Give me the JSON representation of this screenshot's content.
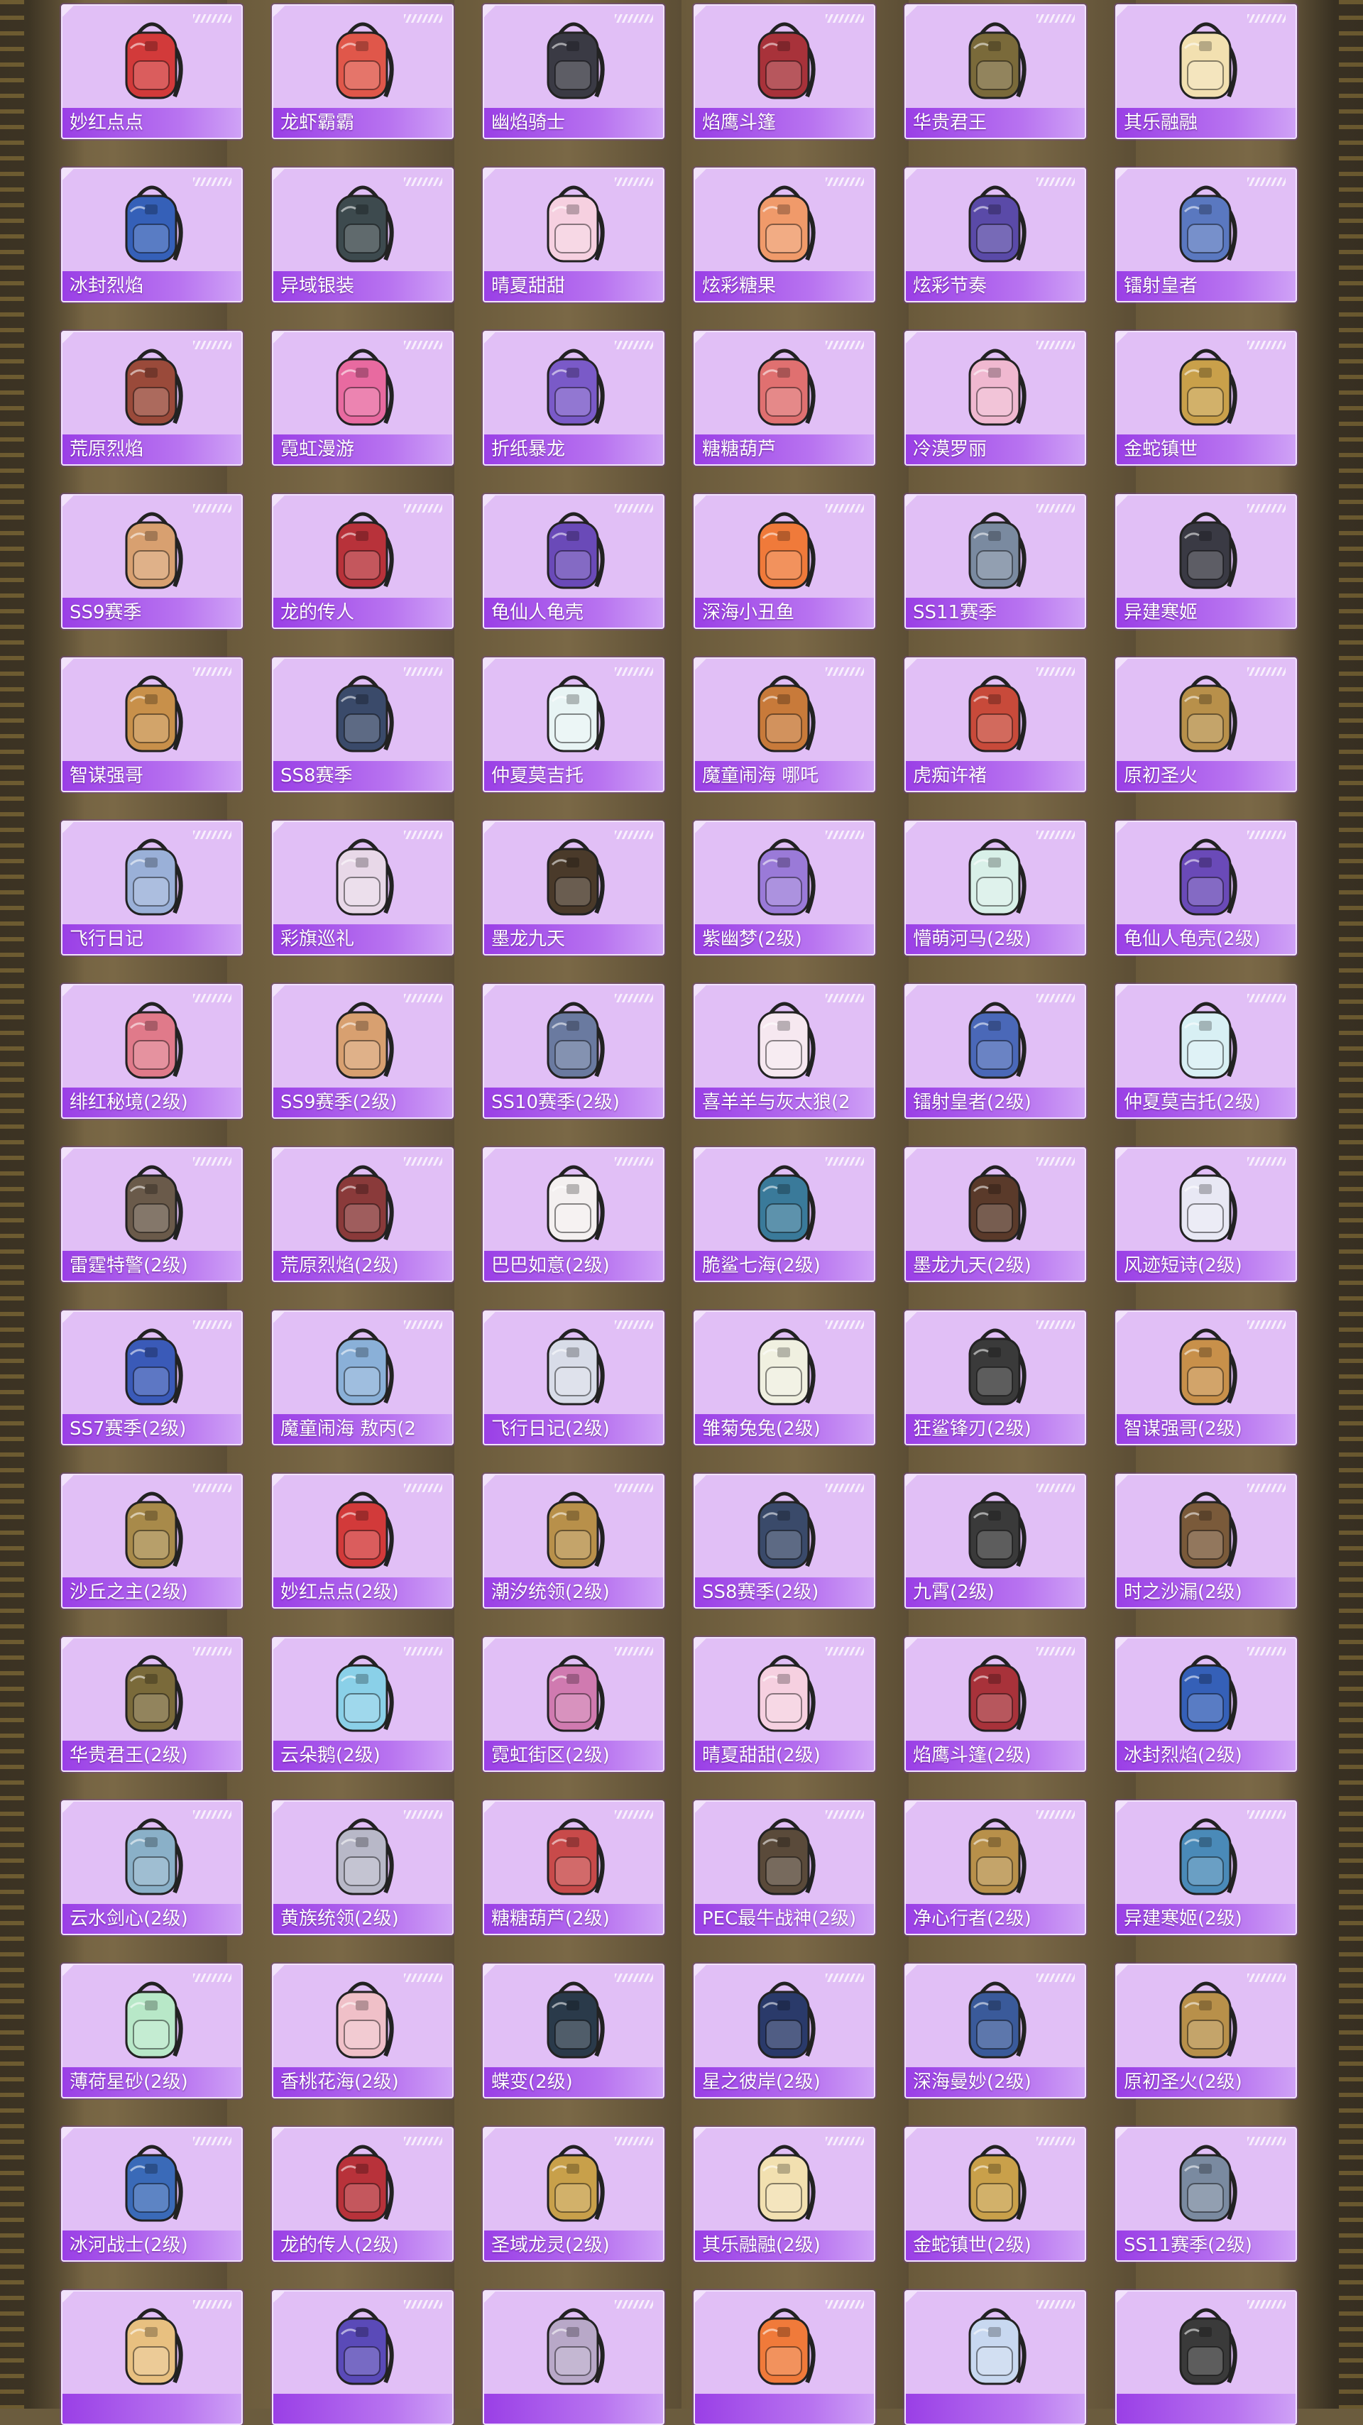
{
  "colors": {
    "card_bg": "#e1bff6",
    "label_bar": "#9a3fe6",
    "label_text": "#ffffff",
    "page_bg": "#6b5c3e"
  },
  "items": [
    {
      "name": "妙红点点",
      "icon": "backpack-icon",
      "color": "#d23a3a"
    },
    {
      "name": "龙虾霸霸",
      "icon": "backpack-icon",
      "color": "#e0574a"
    },
    {
      "name": "幽焰骑士",
      "icon": "backpack-icon",
      "color": "#3a3a44"
    },
    {
      "name": "焰鹰斗篷",
      "icon": "backpack-icon",
      "color": "#a8323a"
    },
    {
      "name": "华贵君王",
      "icon": "backpack-icon",
      "color": "#7a6a3a"
    },
    {
      "name": "其乐融融",
      "icon": "backpack-icon",
      "color": "#f2e0b0"
    },
    {
      "name": "冰封烈焰",
      "icon": "backpack-icon",
      "color": "#3560b8"
    },
    {
      "name": "异域银装",
      "icon": "backpack-icon",
      "color": "#3d4a4e"
    },
    {
      "name": "晴夏甜甜",
      "icon": "backpack-icon",
      "color": "#f6d0e0"
    },
    {
      "name": "炫彩糖果",
      "icon": "backpack-icon",
      "color": "#f09a6a"
    },
    {
      "name": "炫彩节奏",
      "icon": "backpack-icon",
      "color": "#5a4aa8"
    },
    {
      "name": "镭射皇者",
      "icon": "backpack-icon",
      "color": "#5a78c0"
    },
    {
      "name": "荒原烈焰",
      "icon": "backpack-icon",
      "color": "#9a4a3a"
    },
    {
      "name": "霓虹漫游",
      "icon": "backpack-icon",
      "color": "#e86aa0"
    },
    {
      "name": "折纸暴龙",
      "icon": "backpack-icon",
      "color": "#7a5ac8"
    },
    {
      "name": "糖糖葫芦",
      "icon": "backpack-icon",
      "color": "#e07070"
    },
    {
      "name": "冷漠罗丽",
      "icon": "backpack-icon",
      "color": "#f0b8d0"
    },
    {
      "name": "金蛇镇世",
      "icon": "backpack-icon",
      "color": "#c9a04a"
    },
    {
      "name": "SS9赛季",
      "icon": "backpack-icon",
      "color": "#d8a070"
    },
    {
      "name": "龙的传人",
      "icon": "backpack-icon",
      "color": "#b8323a"
    },
    {
      "name": "龟仙人龟壳",
      "icon": "backpack-icon",
      "color": "#6a4ab8"
    },
    {
      "name": "深海小丑鱼",
      "icon": "backpack-icon",
      "color": "#f07a3a"
    },
    {
      "name": "SS11赛季",
      "icon": "backpack-icon",
      "color": "#7a8aa0"
    },
    {
      "name": "异建寒姬",
      "icon": "backpack-icon",
      "color": "#3a3a44"
    },
    {
      "name": "智谋强哥",
      "icon": "backpack-icon",
      "color": "#c8904a"
    },
    {
      "name": "SS8赛季",
      "icon": "backpack-icon",
      "color": "#3a4a6a"
    },
    {
      "name": "仲夏莫吉托",
      "icon": "backpack-icon",
      "color": "#e8f4f4"
    },
    {
      "name": "魔童闹海 哪吒",
      "icon": "backpack-icon",
      "color": "#c87a3a"
    },
    {
      "name": "虎痴许褚",
      "icon": "backpack-icon",
      "color": "#c84a3a"
    },
    {
      "name": "原初圣火",
      "icon": "backpack-icon",
      "color": "#b8904a"
    },
    {
      "name": "飞行日记",
      "icon": "backpack-icon",
      "color": "#9ab0d8"
    },
    {
      "name": "彩旗巡礼",
      "icon": "backpack-icon",
      "color": "#e8d8e8"
    },
    {
      "name": "墨龙九天",
      "icon": "backpack-icon",
      "color": "#4a3a2a"
    },
    {
      "name": "紫幽梦(2级)",
      "icon": "backpack-icon",
      "color": "#9a7ad8"
    },
    {
      "name": "懵萌河马(2级)",
      "icon": "backpack-icon",
      "color": "#d8f0e8"
    },
    {
      "name": "龟仙人龟壳(2级)",
      "icon": "backpack-icon",
      "color": "#6a4ab8"
    },
    {
      "name": "绯红秘境(2级)",
      "icon": "backpack-icon",
      "color": "#e07a8a"
    },
    {
      "name": "SS9赛季(2级)",
      "icon": "backpack-icon",
      "color": "#d8a070"
    },
    {
      "name": "SS10赛季(2级)",
      "icon": "backpack-icon",
      "color": "#6a7aa0"
    },
    {
      "name": "喜羊羊与灰太狼(2",
      "icon": "backpack-icon",
      "color": "#f6e8f0"
    },
    {
      "name": "镭射皇者(2级)",
      "icon": "backpack-icon",
      "color": "#4a68b8"
    },
    {
      "name": "仲夏莫吉托(2级)",
      "icon": "backpack-icon",
      "color": "#d8f0f4"
    },
    {
      "name": "雷霆特警(2级)",
      "icon": "backpack-icon",
      "color": "#6a5a4a"
    },
    {
      "name": "荒原烈焰(2级)",
      "icon": "backpack-icon",
      "color": "#8a3a3a"
    },
    {
      "name": "巴巴如意(2级)",
      "icon": "backpack-icon",
      "color": "#f4f0f0"
    },
    {
      "name": "脆鲨七海(2级)",
      "icon": "backpack-icon",
      "color": "#3a7a9a"
    },
    {
      "name": "墨龙九天(2级)",
      "icon": "backpack-icon",
      "color": "#5a3a2a"
    },
    {
      "name": "风迹短诗(2级)",
      "icon": "backpack-icon",
      "color": "#e8e8f4"
    },
    {
      "name": "SS7赛季(2级)",
      "icon": "backpack-icon",
      "color": "#3a5ab8"
    },
    {
      "name": "魔童闹海 敖丙(2",
      "icon": "backpack-icon",
      "color": "#8ab0d8"
    },
    {
      "name": "飞行日记(2级)",
      "icon": "backpack-icon",
      "color": "#d8dce8"
    },
    {
      "name": "雏菊兔兔(2级)",
      "icon": "backpack-icon",
      "color": "#f0f0e0"
    },
    {
      "name": "狂鲨锋刃(2级)",
      "icon": "backpack-icon",
      "color": "#3a3a3a"
    },
    {
      "name": "智谋强哥(2级)",
      "icon": "backpack-icon",
      "color": "#c8904a"
    },
    {
      "name": "沙丘之主(2级)",
      "icon": "backpack-icon",
      "color": "#a88a4a"
    },
    {
      "name": "妙红点点(2级)",
      "icon": "backpack-icon",
      "color": "#d23a3a"
    },
    {
      "name": "潮汐统领(2级)",
      "icon": "backpack-icon",
      "color": "#b8904a"
    },
    {
      "name": "SS8赛季(2级)",
      "icon": "backpack-icon",
      "color": "#3a4a6a"
    },
    {
      "name": "九霄(2级)",
      "icon": "backpack-icon",
      "color": "#3a3a3a"
    },
    {
      "name": "时之沙漏(2级)",
      "icon": "backpack-icon",
      "color": "#7a5a3a"
    },
    {
      "name": "华贵君王(2级)",
      "icon": "backpack-icon",
      "color": "#7a6a3a"
    },
    {
      "name": "云朵鹅(2级)",
      "icon": "backpack-icon",
      "color": "#8ad0e8"
    },
    {
      "name": "霓虹街区(2级)",
      "icon": "backpack-icon",
      "color": "#d07ab0"
    },
    {
      "name": "晴夏甜甜(2级)",
      "icon": "backpack-icon",
      "color": "#f6d0e0"
    },
    {
      "name": "焰鹰斗篷(2级)",
      "icon": "backpack-icon",
      "color": "#a8323a"
    },
    {
      "name": "冰封烈焰(2级)",
      "icon": "backpack-icon",
      "color": "#3560b8"
    },
    {
      "name": "云水剑心(2级)",
      "icon": "backpack-icon",
      "color": "#8ab0c8"
    },
    {
      "name": "黄族统领(2级)",
      "icon": "backpack-icon",
      "color": "#b8b8c8"
    },
    {
      "name": "糖糖葫芦(2级)",
      "icon": "backpack-icon",
      "color": "#c84a4a"
    },
    {
      "name": "PEC最牛战神(2级)",
      "icon": "backpack-icon",
      "color": "#5a4a3a"
    },
    {
      "name": "净心行者(2级)",
      "icon": "backpack-icon",
      "color": "#b8904a"
    },
    {
      "name": "异建寒姬(2级)",
      "icon": "backpack-icon",
      "color": "#4a8ab8"
    },
    {
      "name": "薄荷星砂(2级)",
      "icon": "backpack-icon",
      "color": "#b8e8c8"
    },
    {
      "name": "香桃花海(2级)",
      "icon": "backpack-icon",
      "color": "#f0c0c8"
    },
    {
      "name": "蝶变(2级)",
      "icon": "backpack-icon",
      "color": "#2a3a4a"
    },
    {
      "name": "星之彼岸(2级)",
      "icon": "backpack-icon",
      "color": "#2a3a6a"
    },
    {
      "name": "深海曼妙(2级)",
      "icon": "backpack-icon",
      "color": "#3a5a9a"
    },
    {
      "name": "原初圣火(2级)",
      "icon": "backpack-icon",
      "color": "#b8904a"
    },
    {
      "name": "冰河战士(2级)",
      "icon": "backpack-icon",
      "color": "#3a6ab8"
    },
    {
      "name": "龙的传人(2级)",
      "icon": "backpack-icon",
      "color": "#b8323a"
    },
    {
      "name": "圣域龙灵(2级)",
      "icon": "backpack-icon",
      "color": "#c8a04a"
    },
    {
      "name": "其乐融融(2级)",
      "icon": "backpack-icon",
      "color": "#f2e0b0"
    },
    {
      "name": "金蛇镇世(2级)",
      "icon": "backpack-icon",
      "color": "#c9a04a"
    },
    {
      "name": "SS11赛季(2级)",
      "icon": "backpack-icon",
      "color": "#7a8aa0"
    },
    {
      "name": "",
      "icon": "backpack-icon",
      "color": "#e8c080"
    },
    {
      "name": "",
      "icon": "backpack-icon",
      "color": "#5a4ab8"
    },
    {
      "name": "",
      "icon": "backpack-icon",
      "color": "#b8a8c8"
    },
    {
      "name": "",
      "icon": "backpack-icon",
      "color": "#f07a3a"
    },
    {
      "name": "",
      "icon": "backpack-icon",
      "color": "#c8d8f0"
    },
    {
      "name": "",
      "icon": "backpack-icon",
      "color": "#3a3a3a"
    }
  ]
}
